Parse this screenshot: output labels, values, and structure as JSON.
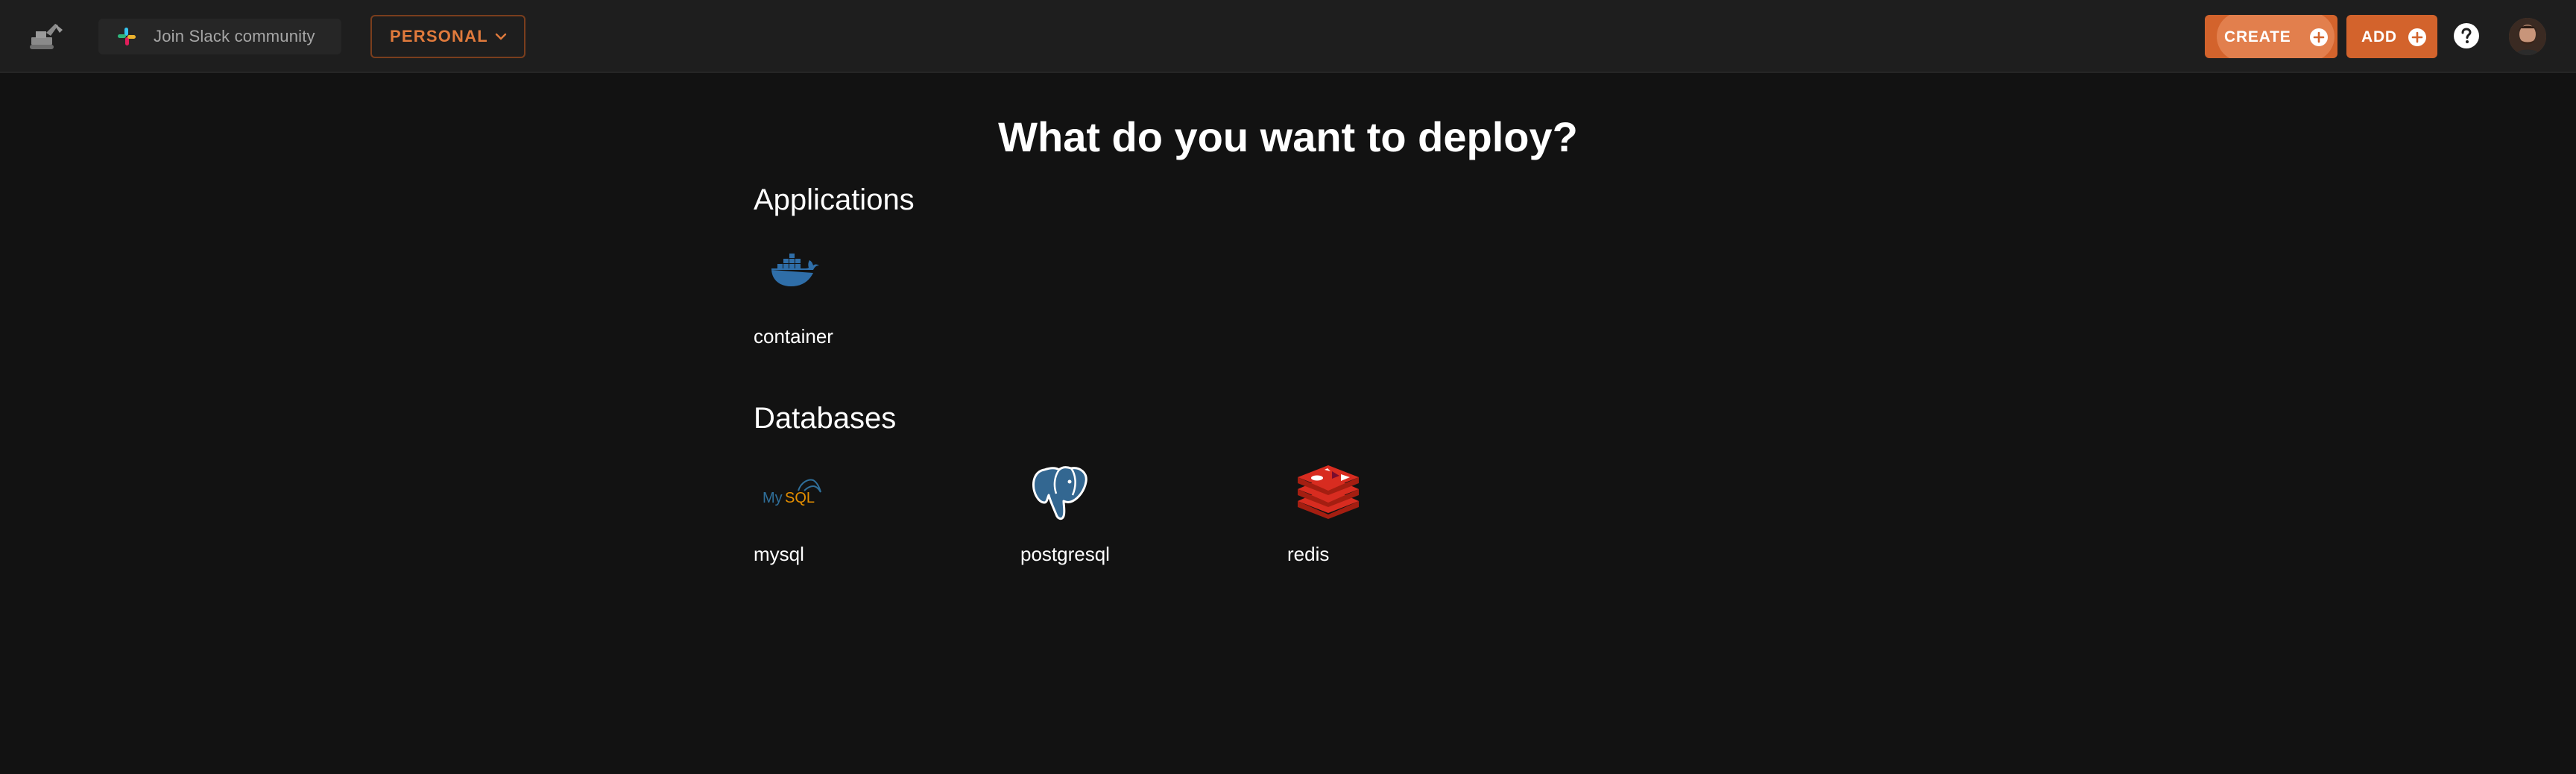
{
  "topbar": {
    "slack_label": "Join Slack community",
    "account_label": "PERSONAL",
    "create_label": "CREATE",
    "add_label": "ADD"
  },
  "main": {
    "title": "What do you want to deploy?",
    "sections": [
      {
        "heading": "Applications",
        "items": [
          {
            "label": "container",
            "icon": "docker-icon"
          }
        ]
      },
      {
        "heading": "Databases",
        "items": [
          {
            "label": "mysql",
            "icon": "mysql-icon"
          },
          {
            "label": "postgresql",
            "icon": "postgresql-icon"
          },
          {
            "label": "redis",
            "icon": "redis-icon"
          }
        ]
      }
    ]
  },
  "colors": {
    "background": "#121212",
    "topbar": "#1e1e1e",
    "accent": "#d3632c",
    "account_text": "#e07a3c"
  }
}
